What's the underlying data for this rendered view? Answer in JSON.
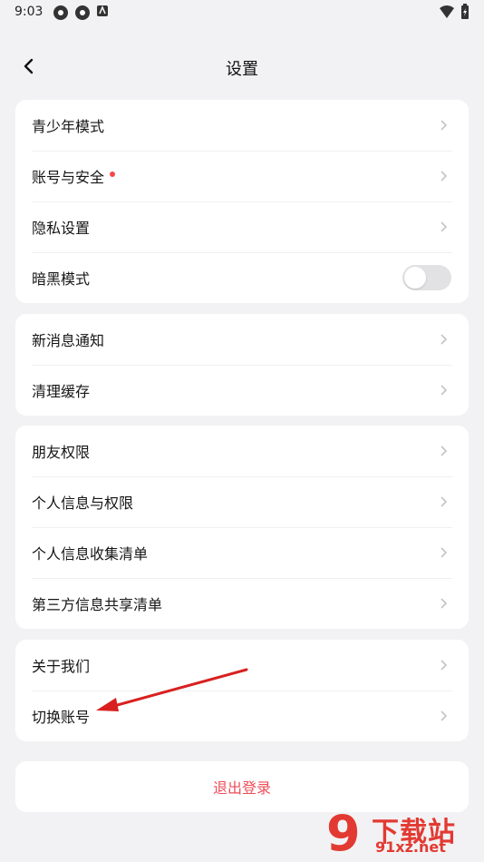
{
  "status_bar": {
    "time": "9:03"
  },
  "header": {
    "title": "设置"
  },
  "groups": [
    {
      "items": [
        {
          "label": "青少年模式",
          "type": "chevron"
        },
        {
          "label": "账号与安全",
          "type": "chevron",
          "badge": true
        },
        {
          "label": "隐私设置",
          "type": "chevron"
        },
        {
          "label": "暗黑模式",
          "type": "toggle",
          "on": false
        }
      ]
    },
    {
      "items": [
        {
          "label": "新消息通知",
          "type": "chevron"
        },
        {
          "label": "清理缓存",
          "type": "chevron"
        }
      ]
    },
    {
      "items": [
        {
          "label": "朋友权限",
          "type": "chevron"
        },
        {
          "label": "个人信息与权限",
          "type": "chevron"
        },
        {
          "label": "个人信息收集清单",
          "type": "chevron"
        },
        {
          "label": "第三方信息共享清单",
          "type": "chevron"
        }
      ]
    },
    {
      "items": [
        {
          "label": "关于我们",
          "type": "chevron"
        },
        {
          "label": "切换账号",
          "type": "chevron"
        }
      ]
    }
  ],
  "logout": {
    "label": "退出登录"
  },
  "colors": {
    "accent_red": "#ee4d58",
    "badge_red": "#f24b4b",
    "background": "#f2f2f4"
  },
  "watermark": {
    "brand": "下载站",
    "url": "91xz.net",
    "mark": "9"
  }
}
